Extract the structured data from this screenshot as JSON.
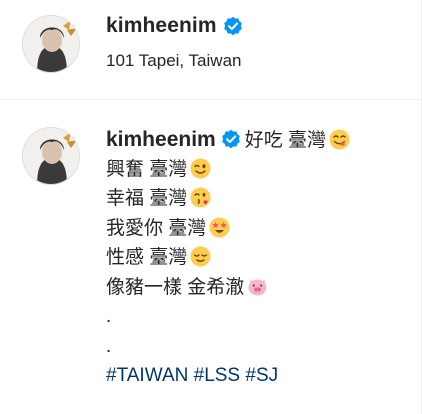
{
  "header": {
    "username": "kimheenim",
    "location": "101 Tapei, Taiwan",
    "verified_icon": "verified-badge-icon",
    "accent_color": "#0095f6"
  },
  "post": {
    "username": "kimheenim",
    "caption_first": "好吃 臺灣",
    "lines": [
      {
        "text": "興奮 臺灣",
        "emoji": "winking-face-icon"
      },
      {
        "text": "幸福 臺灣",
        "emoji": "face-blowing-kiss-icon"
      },
      {
        "text": "我愛你 臺灣",
        "emoji": "star-struck-icon"
      },
      {
        "text": "性感 臺灣",
        "emoji": "relieved-face-icon"
      },
      {
        "text": "像豬一樣 金希澈",
        "emoji": "pig-face-icon"
      }
    ],
    "dot1": ".",
    "dot2": ".",
    "hashtags": [
      "#TAIWAN",
      "#LSS",
      "#SJ"
    ],
    "hashtag_color": "#00376b"
  }
}
